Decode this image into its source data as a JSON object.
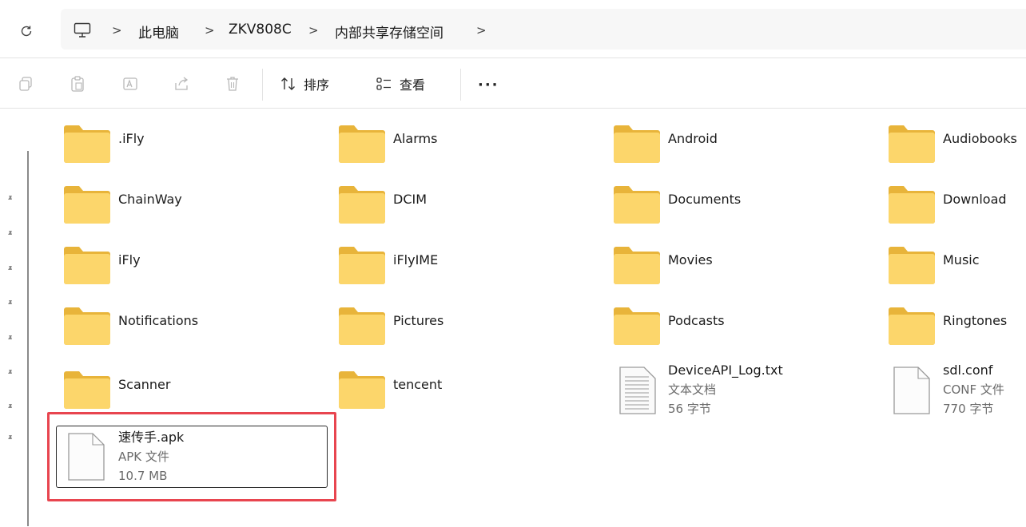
{
  "breadcrumb": {
    "items": [
      "此电脑",
      "ZKV808C",
      "内部共享存储空间"
    ]
  },
  "toolbar": {
    "sort_label": "排序",
    "view_label": "查看",
    "more_label": "···"
  },
  "items": [
    {
      "name": ".iFly",
      "type": "folder"
    },
    {
      "name": "Alarms",
      "type": "folder"
    },
    {
      "name": "Android",
      "type": "folder"
    },
    {
      "name": "Audiobooks",
      "type": "folder"
    },
    {
      "name": "ChainWay",
      "type": "folder"
    },
    {
      "name": "DCIM",
      "type": "folder"
    },
    {
      "name": "Documents",
      "type": "folder"
    },
    {
      "name": "Download",
      "type": "folder"
    },
    {
      "name": "iFly",
      "type": "folder"
    },
    {
      "name": "iFlyIME",
      "type": "folder"
    },
    {
      "name": "Movies",
      "type": "folder"
    },
    {
      "name": "Music",
      "type": "folder"
    },
    {
      "name": "Notifications",
      "type": "folder"
    },
    {
      "name": "Pictures",
      "type": "folder"
    },
    {
      "name": "Podcasts",
      "type": "folder"
    },
    {
      "name": "Ringtones",
      "type": "folder"
    },
    {
      "name": "Scanner",
      "type": "folder"
    },
    {
      "name": "tencent",
      "type": "folder"
    }
  ],
  "files": {
    "log": {
      "name": "DeviceAPI_Log.txt",
      "kind": "文本文档",
      "size": "56 字节"
    },
    "conf": {
      "name": "sdl.conf",
      "kind": "CONF 文件",
      "size": "770 字节"
    },
    "apk": {
      "name": "速传手.apk",
      "kind": "APK 文件",
      "size": "10.7 MB"
    }
  },
  "colors": {
    "folder_back": "#e8b43a",
    "folder_front": "#fcd66b",
    "highlight": "#e8454f"
  }
}
